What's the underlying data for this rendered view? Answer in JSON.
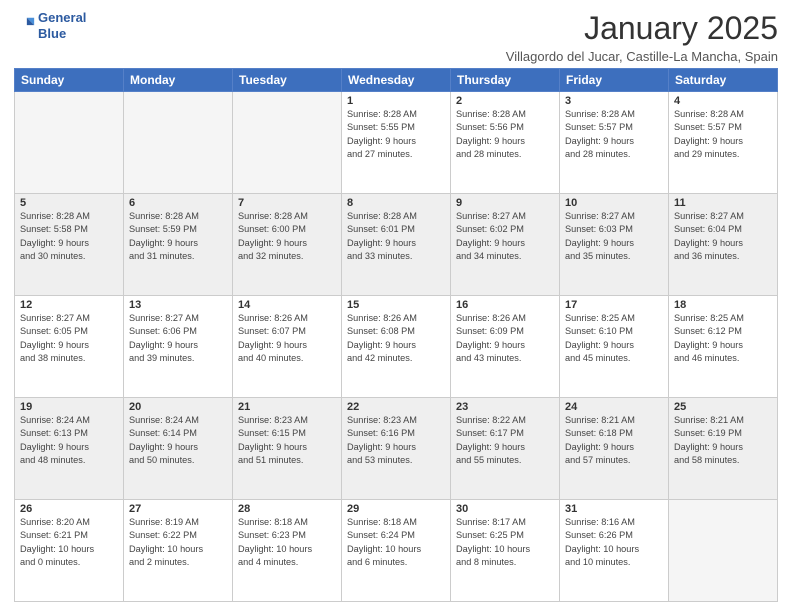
{
  "header": {
    "logo_line1": "General",
    "logo_line2": "Blue",
    "month": "January 2025",
    "location": "Villagordo del Jucar, Castille-La Mancha, Spain"
  },
  "weekdays": [
    "Sunday",
    "Monday",
    "Tuesday",
    "Wednesday",
    "Thursday",
    "Friday",
    "Saturday"
  ],
  "rows": [
    [
      {
        "num": "",
        "info": ""
      },
      {
        "num": "",
        "info": ""
      },
      {
        "num": "",
        "info": ""
      },
      {
        "num": "1",
        "info": "Sunrise: 8:28 AM\nSunset: 5:55 PM\nDaylight: 9 hours\nand 27 minutes."
      },
      {
        "num": "2",
        "info": "Sunrise: 8:28 AM\nSunset: 5:56 PM\nDaylight: 9 hours\nand 28 minutes."
      },
      {
        "num": "3",
        "info": "Sunrise: 8:28 AM\nSunset: 5:57 PM\nDaylight: 9 hours\nand 28 minutes."
      },
      {
        "num": "4",
        "info": "Sunrise: 8:28 AM\nSunset: 5:57 PM\nDaylight: 9 hours\nand 29 minutes."
      }
    ],
    [
      {
        "num": "5",
        "info": "Sunrise: 8:28 AM\nSunset: 5:58 PM\nDaylight: 9 hours\nand 30 minutes."
      },
      {
        "num": "6",
        "info": "Sunrise: 8:28 AM\nSunset: 5:59 PM\nDaylight: 9 hours\nand 31 minutes."
      },
      {
        "num": "7",
        "info": "Sunrise: 8:28 AM\nSunset: 6:00 PM\nDaylight: 9 hours\nand 32 minutes."
      },
      {
        "num": "8",
        "info": "Sunrise: 8:28 AM\nSunset: 6:01 PM\nDaylight: 9 hours\nand 33 minutes."
      },
      {
        "num": "9",
        "info": "Sunrise: 8:27 AM\nSunset: 6:02 PM\nDaylight: 9 hours\nand 34 minutes."
      },
      {
        "num": "10",
        "info": "Sunrise: 8:27 AM\nSunset: 6:03 PM\nDaylight: 9 hours\nand 35 minutes."
      },
      {
        "num": "11",
        "info": "Sunrise: 8:27 AM\nSunset: 6:04 PM\nDaylight: 9 hours\nand 36 minutes."
      }
    ],
    [
      {
        "num": "12",
        "info": "Sunrise: 8:27 AM\nSunset: 6:05 PM\nDaylight: 9 hours\nand 38 minutes."
      },
      {
        "num": "13",
        "info": "Sunrise: 8:27 AM\nSunset: 6:06 PM\nDaylight: 9 hours\nand 39 minutes."
      },
      {
        "num": "14",
        "info": "Sunrise: 8:26 AM\nSunset: 6:07 PM\nDaylight: 9 hours\nand 40 minutes."
      },
      {
        "num": "15",
        "info": "Sunrise: 8:26 AM\nSunset: 6:08 PM\nDaylight: 9 hours\nand 42 minutes."
      },
      {
        "num": "16",
        "info": "Sunrise: 8:26 AM\nSunset: 6:09 PM\nDaylight: 9 hours\nand 43 minutes."
      },
      {
        "num": "17",
        "info": "Sunrise: 8:25 AM\nSunset: 6:10 PM\nDaylight: 9 hours\nand 45 minutes."
      },
      {
        "num": "18",
        "info": "Sunrise: 8:25 AM\nSunset: 6:12 PM\nDaylight: 9 hours\nand 46 minutes."
      }
    ],
    [
      {
        "num": "19",
        "info": "Sunrise: 8:24 AM\nSunset: 6:13 PM\nDaylight: 9 hours\nand 48 minutes."
      },
      {
        "num": "20",
        "info": "Sunrise: 8:24 AM\nSunset: 6:14 PM\nDaylight: 9 hours\nand 50 minutes."
      },
      {
        "num": "21",
        "info": "Sunrise: 8:23 AM\nSunset: 6:15 PM\nDaylight: 9 hours\nand 51 minutes."
      },
      {
        "num": "22",
        "info": "Sunrise: 8:23 AM\nSunset: 6:16 PM\nDaylight: 9 hours\nand 53 minutes."
      },
      {
        "num": "23",
        "info": "Sunrise: 8:22 AM\nSunset: 6:17 PM\nDaylight: 9 hours\nand 55 minutes."
      },
      {
        "num": "24",
        "info": "Sunrise: 8:21 AM\nSunset: 6:18 PM\nDaylight: 9 hours\nand 57 minutes."
      },
      {
        "num": "25",
        "info": "Sunrise: 8:21 AM\nSunset: 6:19 PM\nDaylight: 9 hours\nand 58 minutes."
      }
    ],
    [
      {
        "num": "26",
        "info": "Sunrise: 8:20 AM\nSunset: 6:21 PM\nDaylight: 10 hours\nand 0 minutes."
      },
      {
        "num": "27",
        "info": "Sunrise: 8:19 AM\nSunset: 6:22 PM\nDaylight: 10 hours\nand 2 minutes."
      },
      {
        "num": "28",
        "info": "Sunrise: 8:18 AM\nSunset: 6:23 PM\nDaylight: 10 hours\nand 4 minutes."
      },
      {
        "num": "29",
        "info": "Sunrise: 8:18 AM\nSunset: 6:24 PM\nDaylight: 10 hours\nand 6 minutes."
      },
      {
        "num": "30",
        "info": "Sunrise: 8:17 AM\nSunset: 6:25 PM\nDaylight: 10 hours\nand 8 minutes."
      },
      {
        "num": "31",
        "info": "Sunrise: 8:16 AM\nSunset: 6:26 PM\nDaylight: 10 hours\nand 10 minutes."
      },
      {
        "num": "",
        "info": ""
      }
    ]
  ]
}
